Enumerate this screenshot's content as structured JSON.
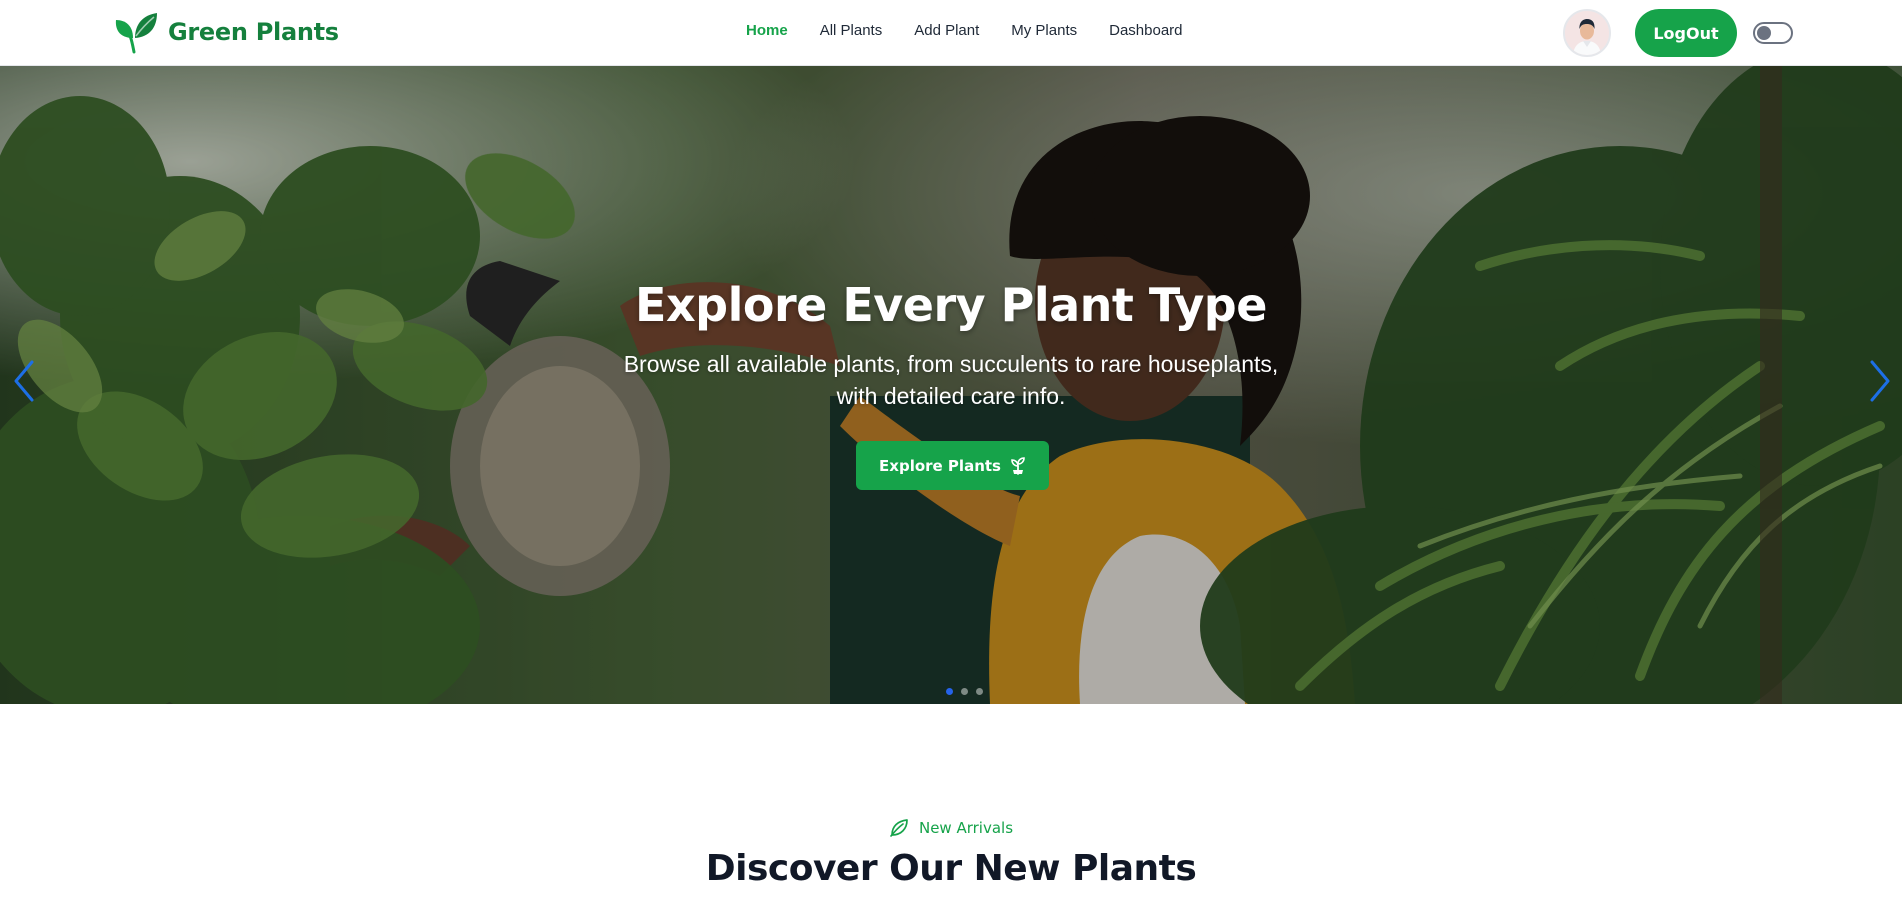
{
  "brand": {
    "name": "Green Plants",
    "logo_icon": "leaf-logo-icon",
    "color": "#15803d"
  },
  "nav": {
    "items": [
      {
        "label": "Home",
        "active": true
      },
      {
        "label": "All Plants",
        "active": false
      },
      {
        "label": "Add Plant",
        "active": false
      },
      {
        "label": "My Plants",
        "active": false
      },
      {
        "label": "Dashboard",
        "active": false
      }
    ],
    "active_color": "#16a34a"
  },
  "header": {
    "avatar_icon": "user-avatar",
    "logout_label": "LogOut",
    "theme_toggle_icon": "theme-toggle-switch",
    "theme_dark": false
  },
  "hero": {
    "title": "Explore Every Plant Type",
    "subtitle": "Browse all available plants, from succulents to rare houseplants, with detailed care info.",
    "cta_label": "Explore Plants",
    "cta_icon": "seedling-icon",
    "prev_icon": "chevron-left-icon",
    "next_icon": "chevron-right-icon",
    "slides_total": 3,
    "active_slide": 1,
    "accent": "#16a34a"
  },
  "section": {
    "tag_icon": "leaf-outline-icon",
    "tag": "New Arrivals",
    "title": "Discover Our New Plants"
  }
}
